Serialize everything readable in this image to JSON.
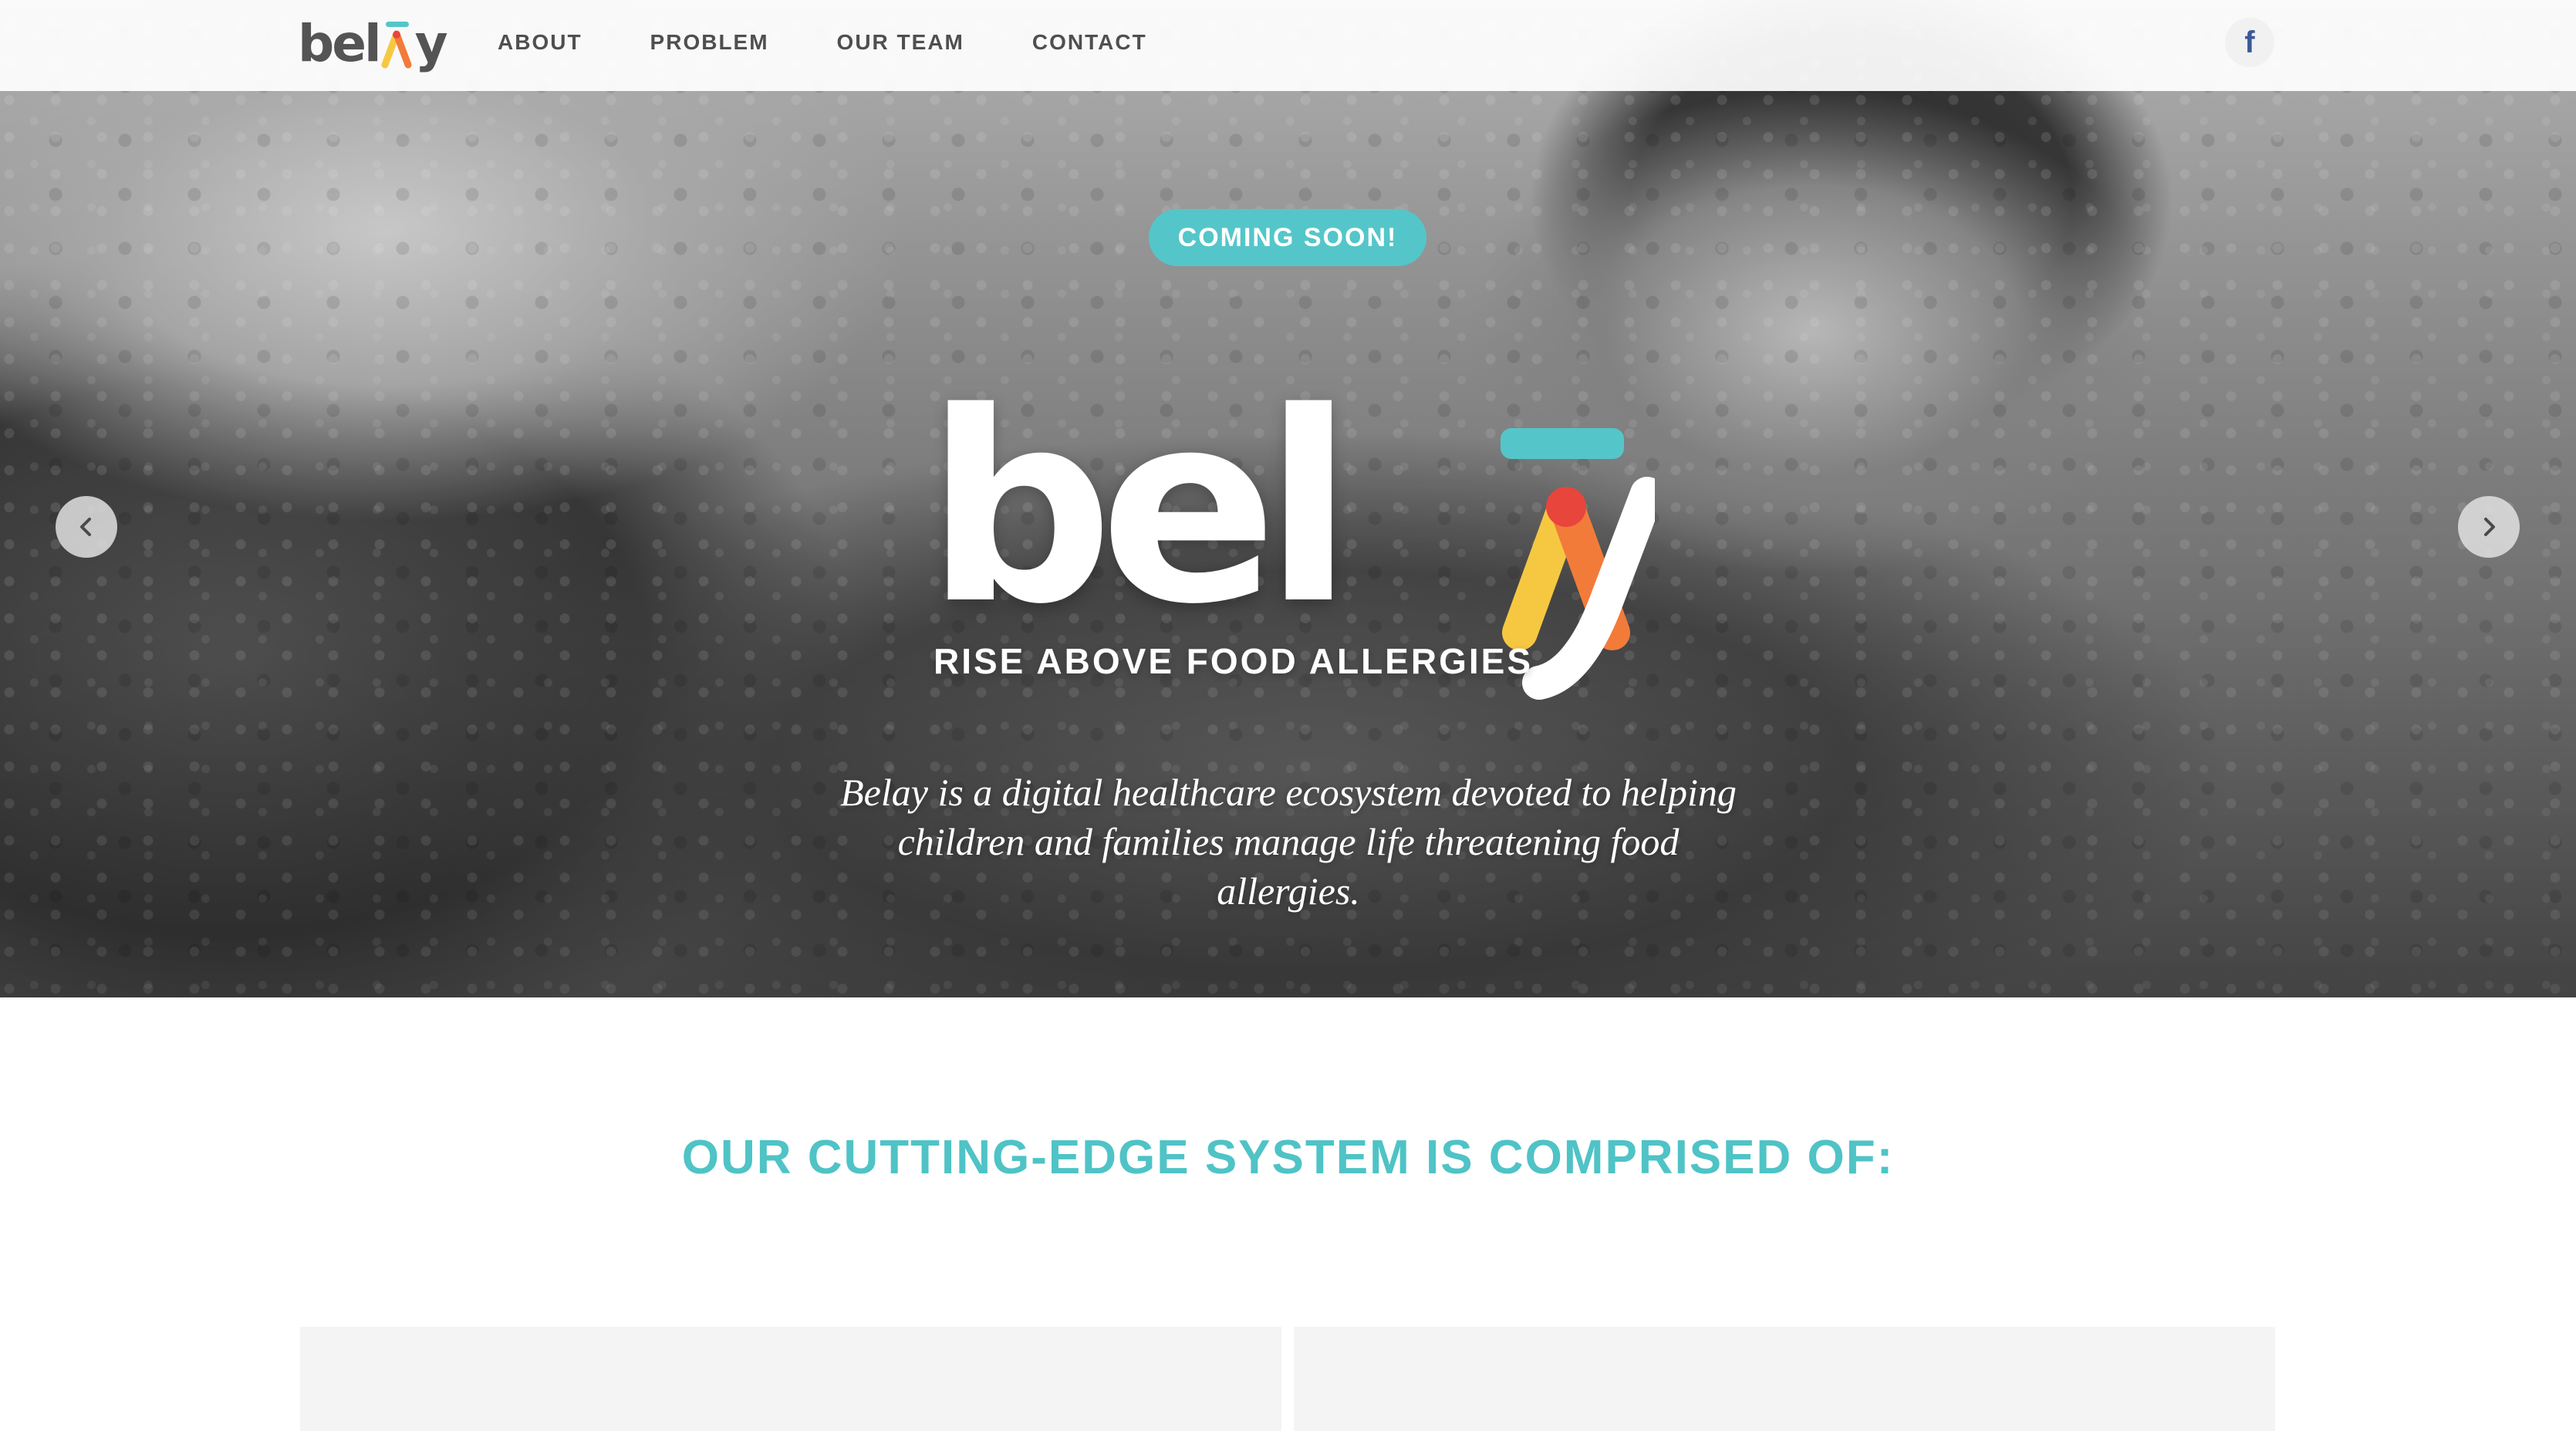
{
  "brand": {
    "logo_text": "bel",
    "logo_text_tail": "y",
    "accent_teal": "#54c6c9",
    "accent_yellow": "#f6c842",
    "accent_orange": "#f27b3a",
    "accent_red": "#e8453c"
  },
  "nav": {
    "items": [
      {
        "label": "ABOUT"
      },
      {
        "label": "PROBLEM"
      },
      {
        "label": "OUR TEAM"
      },
      {
        "label": "CONTACT"
      }
    ],
    "social_icon": "facebook-icon",
    "social_glyph": "f"
  },
  "hero": {
    "badge": "COMING SOON!",
    "logo_word": "bel",
    "logo_tail": "y",
    "tagline": "RISE ABOVE FOOD ALLERGIES",
    "description": "Belay is a digital healthcare ecosystem devoted to helping children and families manage life threatening food allergies.",
    "prev_icon": "chevron-left-icon",
    "next_icon": "chevron-right-icon"
  },
  "section": {
    "heading": "OUR CUTTING-EDGE SYSTEM IS COMPRISED OF:"
  }
}
